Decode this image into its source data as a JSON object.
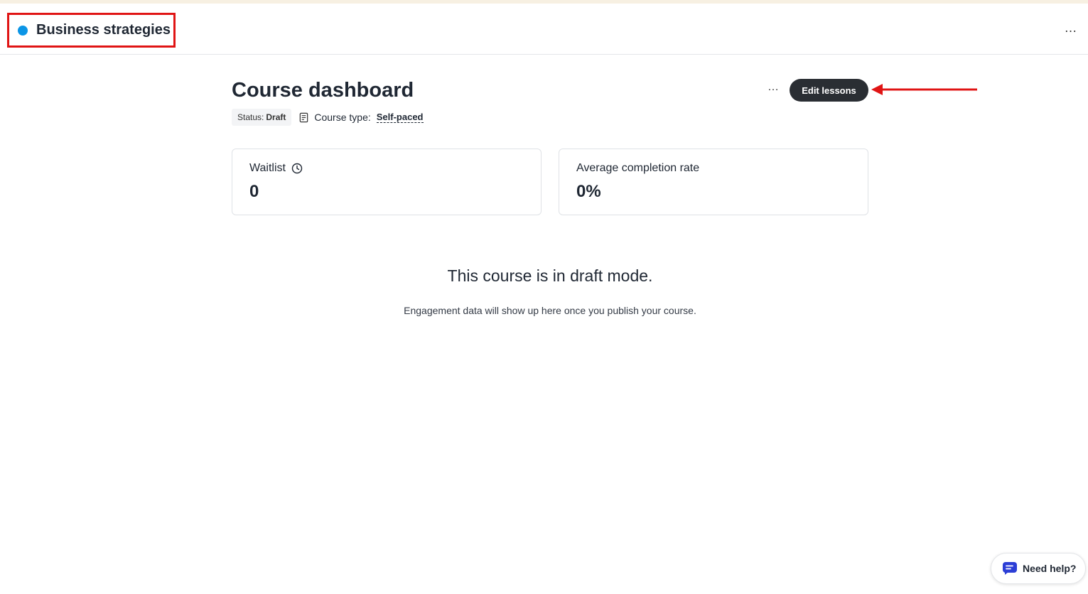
{
  "header": {
    "course_title": "Business strategies",
    "status_dot_color": "#0b95e6",
    "more_icon": "…"
  },
  "dashboard": {
    "title": "Course dashboard",
    "status_label": "Status:",
    "status_value": "Draft",
    "course_type_label": "Course type:",
    "course_type_value": "Self-paced",
    "more_icon": "…",
    "edit_button_label": "Edit lessons"
  },
  "stats": [
    {
      "label": "Waitlist",
      "value": "0",
      "icon": "clock-icon"
    },
    {
      "label": "Average completion rate",
      "value": "0%"
    }
  ],
  "draft_notice": {
    "title": "This course is in draft mode.",
    "subtitle": "Engagement data will show up here once you publish your course."
  },
  "help": {
    "label": "Need help?",
    "icon": "chat-icon"
  },
  "colors": {
    "annotation": "#e01414",
    "button_bg": "#2a2e33",
    "top_strip": "#f7f0e2"
  }
}
